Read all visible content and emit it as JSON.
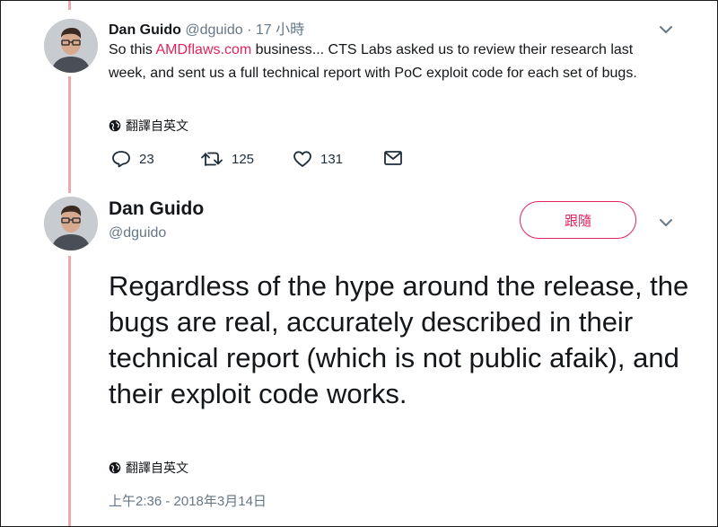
{
  "tweet1": {
    "author_name": "Dan Guido",
    "author_handle": "@dguido",
    "separator": "·",
    "time": "17 小時",
    "text_link": "AMDflaws.com",
    "text_before": "So this ",
    "text_after": " business... CTS Labs asked us to review their research last week, and sent us a full technical report with PoC exploit code for each set of bugs.",
    "translate_label": "翻譯自英文",
    "reply_count": "23",
    "retweet_count": "125",
    "like_count": "131"
  },
  "tweet2": {
    "author_name": "Dan Guido",
    "author_handle": "@dguido",
    "follow_label": "跟隨",
    "text": "Regardless of the hype around the release, the bugs are real, accurately described in their technical report (which is not public afaik), and their exploit code works.",
    "translate_label": "翻譯自英文",
    "timestamp": "上午2:36 - 2018年3月14日"
  },
  "icons": {
    "caret": "chevron-down-icon",
    "reply": "reply-icon",
    "retweet": "retweet-icon",
    "like": "heart-icon",
    "dm": "envelope-icon",
    "translate": "globe-icon"
  },
  "colors": {
    "accent": "#e0245e",
    "thread_line": "#f0a8ad",
    "secondary_text": "#657786"
  }
}
